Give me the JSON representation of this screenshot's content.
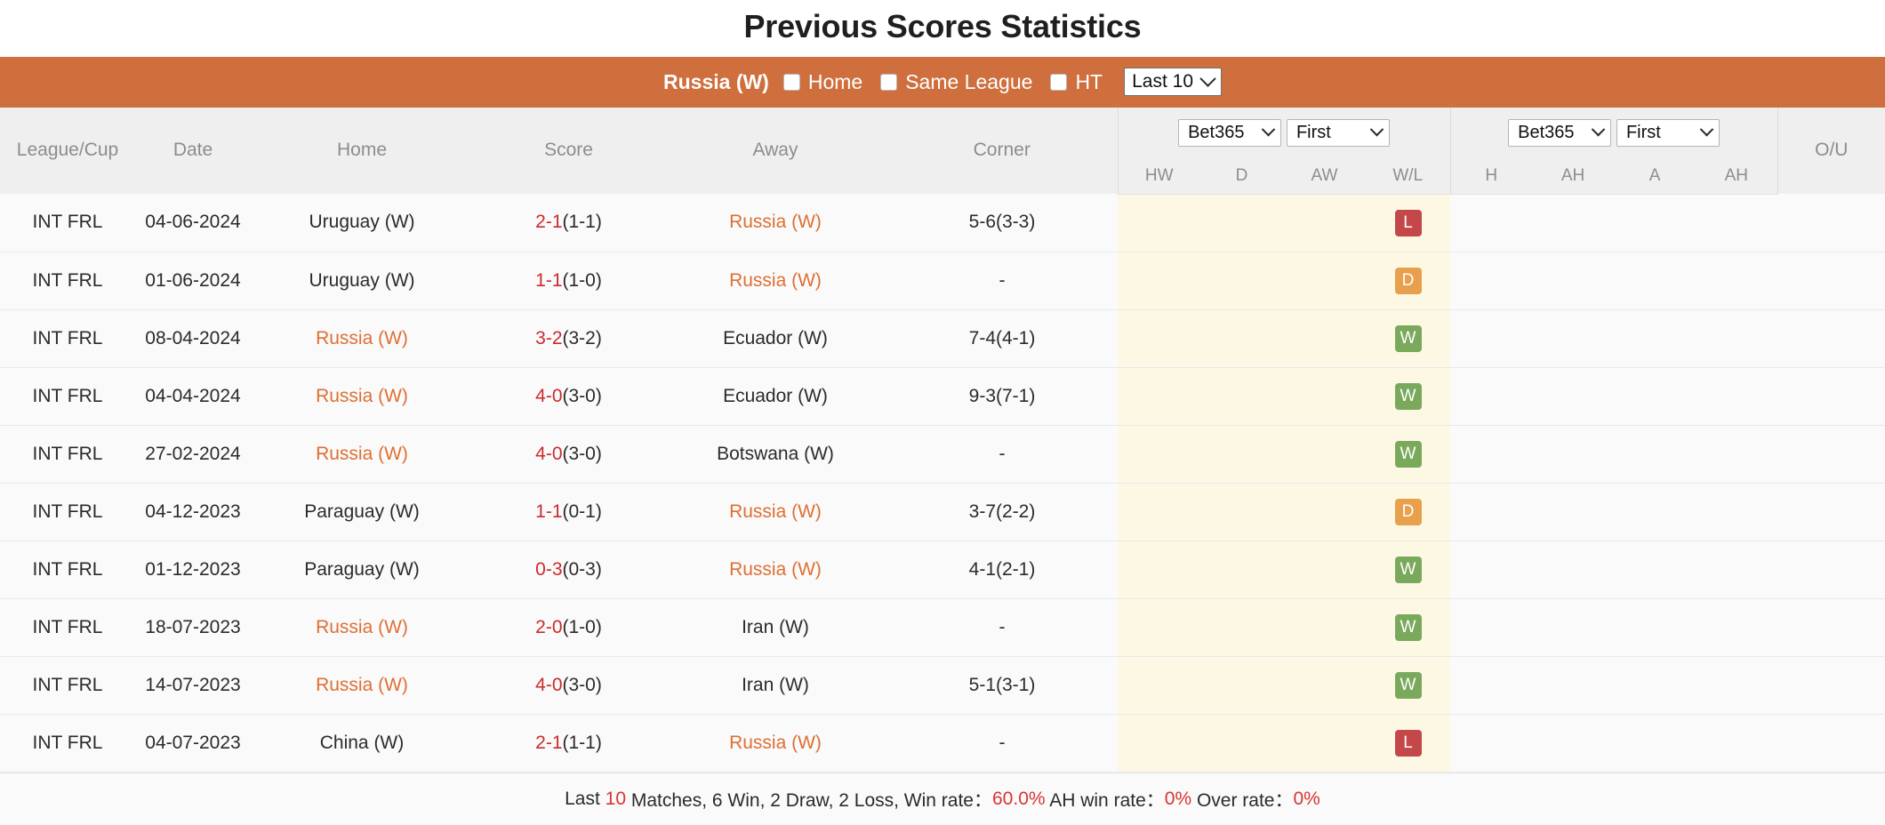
{
  "page": {
    "title": "Previous Scores Statistics"
  },
  "filter_bar": {
    "team": "Russia (W)",
    "checkboxes": [
      {
        "label": "Home",
        "checked": false
      },
      {
        "label": "Same League",
        "checked": false
      },
      {
        "label": "HT",
        "checked": false
      }
    ],
    "range_select": {
      "value": "Last 10",
      "icon": "chevron-down-icon"
    }
  },
  "table": {
    "columns": [
      "League/Cup",
      "Date",
      "Home",
      "Score",
      "Away",
      "Corner"
    ],
    "odds_group_1": {
      "bookmaker_select": {
        "value": "Bet365",
        "icon": "chevron-down-icon"
      },
      "phase_select": {
        "value": "First",
        "icon": "chevron-down-icon"
      },
      "subheaders": [
        "HW",
        "D",
        "AW",
        "W/L"
      ]
    },
    "odds_group_2": {
      "bookmaker_select": {
        "value": "Bet365",
        "icon": "chevron-down-icon"
      },
      "phase_select": {
        "value": "First",
        "icon": "chevron-down-icon"
      },
      "subheaders": [
        "H",
        "AH",
        "A",
        "AH"
      ]
    },
    "ou_column": "O/U",
    "rows": [
      {
        "league": "INT FRL",
        "date": "04-06-2024",
        "home": "Uruguay (W)",
        "home_highlight": false,
        "score_main": "2-1",
        "score_ht": "(1-1)",
        "away": "Russia (W)",
        "away_highlight": true,
        "corner": "5-6(3-3)",
        "hw": "",
        "d": "",
        "aw": "",
        "wl": "L",
        "h": "",
        "ah1": "",
        "a": "",
        "ah2": "",
        "ou": ""
      },
      {
        "league": "INT FRL",
        "date": "01-06-2024",
        "home": "Uruguay (W)",
        "home_highlight": false,
        "score_main": "1-1",
        "score_ht": "(1-0)",
        "away": "Russia (W)",
        "away_highlight": true,
        "corner": "-",
        "hw": "",
        "d": "",
        "aw": "",
        "wl": "D",
        "h": "",
        "ah1": "",
        "a": "",
        "ah2": "",
        "ou": ""
      },
      {
        "league": "INT FRL",
        "date": "08-04-2024",
        "home": "Russia (W)",
        "home_highlight": true,
        "score_main": "3-2",
        "score_ht": "(3-2)",
        "away": "Ecuador (W)",
        "away_highlight": false,
        "corner": "7-4(4-1)",
        "hw": "",
        "d": "",
        "aw": "",
        "wl": "W",
        "h": "",
        "ah1": "",
        "a": "",
        "ah2": "",
        "ou": ""
      },
      {
        "league": "INT FRL",
        "date": "04-04-2024",
        "home": "Russia (W)",
        "home_highlight": true,
        "score_main": "4-0",
        "score_ht": "(3-0)",
        "away": "Ecuador (W)",
        "away_highlight": false,
        "corner": "9-3(7-1)",
        "hw": "",
        "d": "",
        "aw": "",
        "wl": "W",
        "h": "",
        "ah1": "",
        "a": "",
        "ah2": "",
        "ou": ""
      },
      {
        "league": "INT FRL",
        "date": "27-02-2024",
        "home": "Russia (W)",
        "home_highlight": true,
        "score_main": "4-0",
        "score_ht": "(3-0)",
        "away": "Botswana (W)",
        "away_highlight": false,
        "corner": "-",
        "hw": "",
        "d": "",
        "aw": "",
        "wl": "W",
        "h": "",
        "ah1": "",
        "a": "",
        "ah2": "",
        "ou": ""
      },
      {
        "league": "INT FRL",
        "date": "04-12-2023",
        "home": "Paraguay (W)",
        "home_highlight": false,
        "score_main": "1-1",
        "score_ht": "(0-1)",
        "away": "Russia (W)",
        "away_highlight": true,
        "corner": "3-7(2-2)",
        "hw": "",
        "d": "",
        "aw": "",
        "wl": "D",
        "h": "",
        "ah1": "",
        "a": "",
        "ah2": "",
        "ou": ""
      },
      {
        "league": "INT FRL",
        "date": "01-12-2023",
        "home": "Paraguay (W)",
        "home_highlight": false,
        "score_main": "0-3",
        "score_ht": "(0-3)",
        "away": "Russia (W)",
        "away_highlight": true,
        "corner": "4-1(2-1)",
        "hw": "",
        "d": "",
        "aw": "",
        "wl": "W",
        "h": "",
        "ah1": "",
        "a": "",
        "ah2": "",
        "ou": ""
      },
      {
        "league": "INT FRL",
        "date": "18-07-2023",
        "home": "Russia (W)",
        "home_highlight": true,
        "score_main": "2-0",
        "score_ht": "(1-0)",
        "away": "Iran (W)",
        "away_highlight": false,
        "corner": "-",
        "hw": "",
        "d": "",
        "aw": "",
        "wl": "W",
        "h": "",
        "ah1": "",
        "a": "",
        "ah2": "",
        "ou": ""
      },
      {
        "league": "INT FRL",
        "date": "14-07-2023",
        "home": "Russia (W)",
        "home_highlight": true,
        "score_main": "4-0",
        "score_ht": "(3-0)",
        "away": "Iran (W)",
        "away_highlight": false,
        "corner": "5-1(3-1)",
        "hw": "",
        "d": "",
        "aw": "",
        "wl": "W",
        "h": "",
        "ah1": "",
        "a": "",
        "ah2": "",
        "ou": ""
      },
      {
        "league": "INT FRL",
        "date": "04-07-2023",
        "home": "China (W)",
        "home_highlight": false,
        "score_main": "2-1",
        "score_ht": "(1-1)",
        "away": "Russia (W)",
        "away_highlight": true,
        "corner": "-",
        "hw": "",
        "d": "",
        "aw": "",
        "wl": "L",
        "h": "",
        "ah1": "",
        "a": "",
        "ah2": "",
        "ou": ""
      }
    ]
  },
  "summary": {
    "prefix": "Last ",
    "matches_count": "10",
    "middle": " Matches, 6 Win, 2 Draw, 2 Loss, Win rate：",
    "win_rate": "60.0%",
    "ah_label": " AH win rate：",
    "ah_rate": "0%",
    "over_label": " Over rate：",
    "over_rate": "0%"
  },
  "colors": {
    "accent_orange": "#cf6f3e",
    "team_highlight": "#de6f33",
    "score_red": "#cc2b2b",
    "highlight_cell": "#fdf8e4",
    "badge_win": "#7aa95c",
    "badge_draw": "#e8a04d",
    "badge_loss": "#c4474a"
  }
}
